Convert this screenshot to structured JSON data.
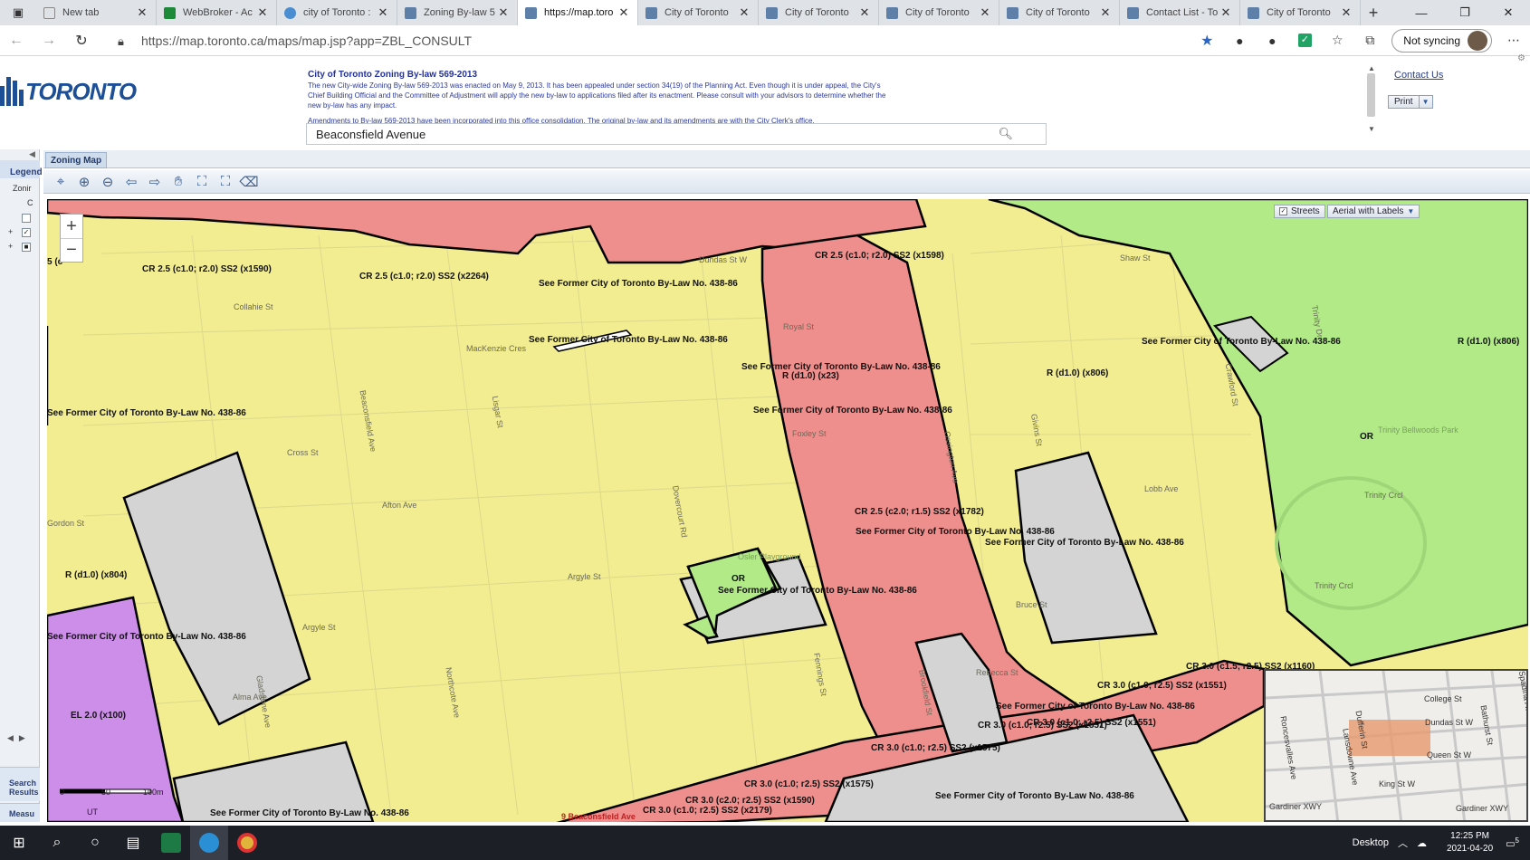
{
  "browser": {
    "tabs": [
      {
        "title": "",
        "icon": "tab-actions-icon"
      },
      {
        "title": "New tab",
        "icon": "blank-page-icon"
      },
      {
        "title": "WebBroker - Ac",
        "icon": "td-logo-icon"
      },
      {
        "title": "city of Toronto :",
        "icon": "search-engine-icon"
      },
      {
        "title": "Zoning By-law 5",
        "icon": "toronto-logo-icon"
      },
      {
        "title": "https://map.toro",
        "icon": "toronto-logo-icon",
        "active": true
      },
      {
        "title": "City of Toronto",
        "icon": "toronto-logo-icon"
      },
      {
        "title": "City of Toronto",
        "icon": "toronto-logo-icon"
      },
      {
        "title": "City of Toronto",
        "icon": "toronto-logo-icon"
      },
      {
        "title": "City of Toronto",
        "icon": "toronto-logo-icon"
      },
      {
        "title": "Contact List - To",
        "icon": "toronto-logo-icon"
      },
      {
        "title": "City of Toronto",
        "icon": "toronto-logo-icon"
      }
    ],
    "url": "https://map.toronto.ca/maps/map.jsp?app=ZBL_CONSULT",
    "sync_label": "Not syncing"
  },
  "header": {
    "logo_text": "TORONTO",
    "notice_title": "City of Toronto Zoning By-law 569-2013",
    "notice_body": "The new City-wide Zoning By-law 569-2013 was enacted on May 9, 2013. It has been appealed under section 34(19) of the Planning Act. Even though it is under appeal, the City's Chief Building Official and the Committee of Adjustment will apply the new by-law to applications filed after its enactment. Please consult with your advisors to determine whether the new by-law has any impact.",
    "amend_before": "Amendments to By-law 569-2013 have been incorporated into this",
    "amend_link": "office consolidation",
    "amend_after": ". The original by-law and its amendments  are with the City Clerk's office.",
    "search_value": "Beaconsfield Avenue",
    "contact_label": "Contact Us",
    "print_label": "Print"
  },
  "sidebar": {
    "legend_label": "Legend",
    "zoning_label": "Zonir",
    "c_label": "C",
    "search_results_label": "Search Results",
    "measure_label": "Measu"
  },
  "map": {
    "tab_label": "Zoning Map",
    "streets_label": "Streets",
    "aerial_label": "Aerial with Labels",
    "scale_labels": [
      "0",
      "50",
      "100m"
    ],
    "scale_unit": "UT",
    "zone_labels": [
      "5 (c",
      "CR 2.5 (c1.0; r2.0) SS2 (x1590)",
      "CR 2.5 (c1.0; r2.0) SS2 (x2264)",
      "CR 2.5 (c1.0; r2.0) SS2 (x1598)",
      "See Former City of Toronto By-Law No. 438-86",
      "See Former City of Toronto By-Law No. 438-86",
      "See Former City of Toronto By-Law No. 438-86",
      "R (d1.0) (x23)",
      "See Former City of Toronto By-Law No. 438-86",
      "See Former City of Toronto By-Law No. 438-86",
      "R (d1.0) (x806)",
      "See Former City of Toronto By-Law No. 438-86",
      "R (d1.0) (x806)",
      "OR",
      "CR 2.5 (c2.0; r1.5) SS2 (x1782)",
      "See Former City of Toronto By-Law No. 438-86",
      "See Former City of Toronto By-Law No. 438-86",
      "R (d1.0) (x804)",
      "OR",
      "See Former City of Toronto By-Law No. 438-86",
      "See Former City of Toronto By-Law No. 438-86",
      "EL 2.0 (x100)",
      "CR 3.0 (c1.5; r2.5) SS2 (x1160)",
      "CR 3.0 (c1.0; r2.5) SS2 (x1551)",
      "See Former City of Toronto By-Law No. 438-86",
      "CR 3.0 (c1.0; r2.5) SS2 (x1551)",
      "CR 3.0 (c1.0; r2.5) SS2 (x1575)",
      "CR 3.0 (c1.0; r2.5) SS2 (x1575)",
      "CR 3.0 (c2.0; r2.5) SS2 (x1590)",
      "CR 3.0 (c1.0; r2.5) SS2 (x2179)",
      "See Former City of Toronto By-Law No. 438-86",
      "See Former City of Toronto By-Law No. 438-86",
      "CR 3.0 (c1.0; r2.5) SS2 (x1551)"
    ],
    "street_labels": [
      "Dundas St W",
      "Collahie St",
      "MacKenzie Cres",
      "Royal St",
      "Beaconsfield Ave",
      "Lisgar St",
      "Cross St",
      "Afton Ave",
      "Gordon St",
      "Argyle St",
      "Argyle St",
      "Dovercourt Rd",
      "Foxley St",
      "Ossington Ave",
      "Gladstone Ave",
      "Alma Ave",
      "Northcote Ave",
      "Fennings St",
      "Brookfield St",
      "Givins St",
      "Crawford St",
      "Lobb Ave",
      "Trinity Crcl",
      "Trinity Crcl",
      "Shaw St",
      "Bruce St",
      "Rebecca St",
      "Osler Playground",
      "Trinity Bellwoods Park",
      "Trinity Dr"
    ],
    "address_label": "9 Beaconsfield Ave",
    "overview_labels": [
      "College St",
      "Dundas St W",
      "Queen St W",
      "King St W",
      "Gardiner XWY",
      "Gardiner XWY",
      "Lansdowne Ave",
      "Dufferin St",
      "Bathurst St",
      "Spadina Ave",
      "Roncesvalles Ave"
    ]
  },
  "taskbar": {
    "desktop_label": "Desktop",
    "time": "12:25 PM",
    "date": "2021-04-20",
    "notif_count": "5"
  },
  "colors": {
    "residential": "#f2ed90",
    "commercial_residential": "#ef8f8d",
    "open_space": "#b2ea88",
    "employment": "#cc8ee8",
    "former_bylaw": "#d4d4d4"
  }
}
